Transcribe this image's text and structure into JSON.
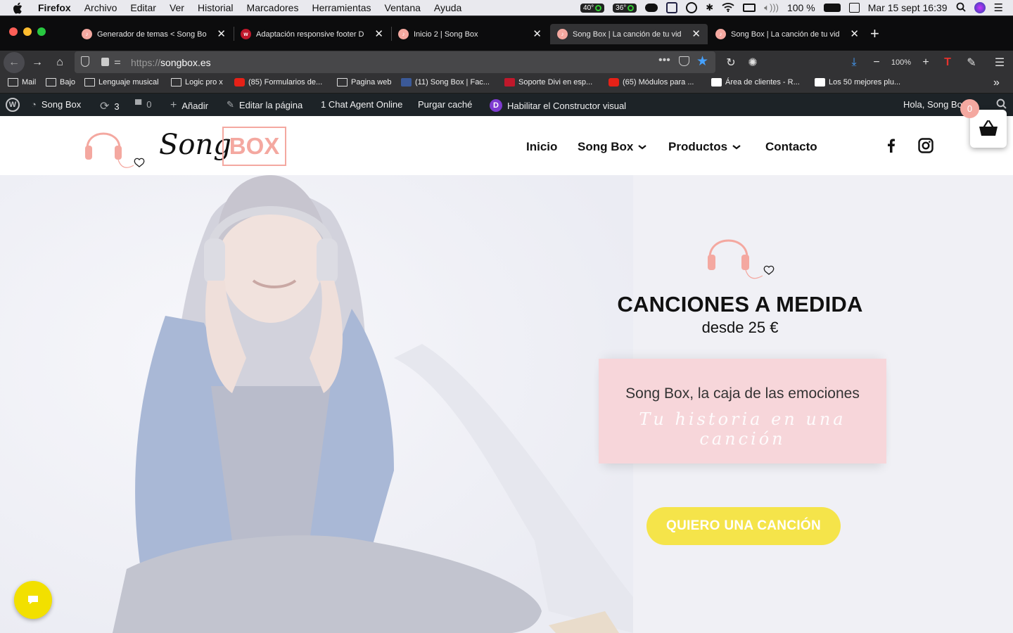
{
  "menubar": {
    "app": "Firefox",
    "items": [
      "Archivo",
      "Editar",
      "Ver",
      "Historial",
      "Marcadores",
      "Herramientas",
      "Ventana",
      "Ayuda"
    ],
    "temp1": "40°",
    "temp2": "36°",
    "battery": "100 %",
    "clock": "Mar 15 sept  16:39"
  },
  "tabs": [
    {
      "title": "Generador de temas < Song Bo",
      "active": false
    },
    {
      "title": "Adaptación responsive footer D",
      "active": false
    },
    {
      "title": "Inicio 2 | Song Box",
      "active": false
    },
    {
      "title": "Song Box | La canción de tu vid",
      "active": true
    },
    {
      "title": "Song Box | La canción de tu vid",
      "active": false
    }
  ],
  "urlbar": {
    "prefix": "https://",
    "domain": "songbox.es",
    "zoom": "100%"
  },
  "bookmarks": [
    {
      "label": "Mail",
      "icon": "folder-icon"
    },
    {
      "label": "Bajo",
      "icon": "folder-icon"
    },
    {
      "label": "Lenguaje musical",
      "icon": "folder-icon"
    },
    {
      "label": "Logic pro x",
      "icon": "folder-icon"
    },
    {
      "label": "(85) Formularios de...",
      "icon": "youtube-icon"
    },
    {
      "label": "Pagina web",
      "icon": "folder-icon"
    },
    {
      "label": "(11) Song Box | Fac...",
      "icon": "facebook-icon"
    },
    {
      "label": "Soporte Divi en esp...",
      "icon": "w-icon"
    },
    {
      "label": "(65) Módulos para ...",
      "icon": "youtube-icon"
    },
    {
      "label": "Área de clientes - R...",
      "icon": "ra-icon"
    },
    {
      "label": "Los 50 mejores plu...",
      "icon": "wp-icon"
    }
  ],
  "wpadmin": {
    "site": "Song Box",
    "updates": "3",
    "comments": "0",
    "add": "Añadir",
    "edit": "Editar la página",
    "chat": "1 Chat Agent Online",
    "cache": "Purgar caché",
    "builder": "Habilitar el Constructor visual",
    "greeting": "Hola, Song Box"
  },
  "site": {
    "logo_word": "Song",
    "logo_box": "BOX",
    "nav": [
      {
        "label": "Inicio",
        "dropdown": false
      },
      {
        "label": "Song Box",
        "dropdown": true
      },
      {
        "label": "Productos",
        "dropdown": true
      },
      {
        "label": "Contacto",
        "dropdown": false
      }
    ],
    "cart_count": "0"
  },
  "hero": {
    "title": "CANCIONES A MEDIDA",
    "subtitle": "desde 25 €",
    "box_line1": "Song Box, la caja de las emociones",
    "box_line2": "Tu historia en una canción",
    "cta": "QUIERO UNA CANCIÓN"
  },
  "colors": {
    "brand_pink": "#f4a8a0",
    "cta_yellow": "#f5e44a",
    "box_pink": "#f7d6da",
    "chat_yellow": "#f2e000"
  }
}
